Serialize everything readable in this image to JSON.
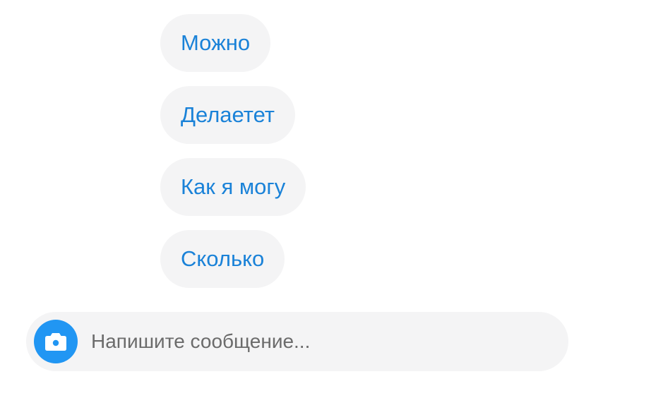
{
  "suggestions": [
    {
      "label": "Можно"
    },
    {
      "label": "Делаетет"
    },
    {
      "label": "Как я могу"
    },
    {
      "label": "Сколько"
    }
  ],
  "composer": {
    "placeholder": "Напишите сообщение...",
    "value": "",
    "camera_icon": "camera-icon"
  },
  "colors": {
    "accent": "#2196f3",
    "chip_text": "#1a82d8",
    "chip_bg": "#f4f4f5"
  }
}
